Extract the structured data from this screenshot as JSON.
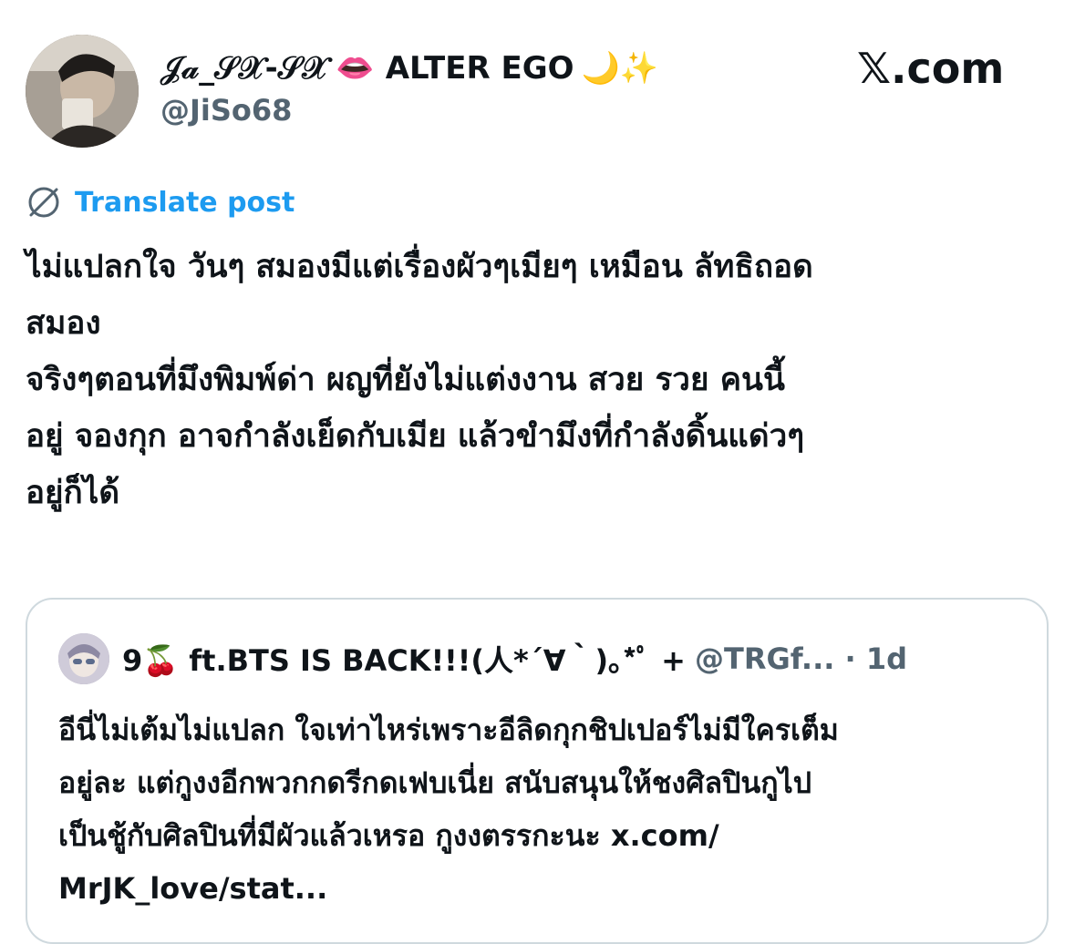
{
  "post": {
    "author": {
      "display_name": "𝒥𝒶_𝒮𝒳-𝒮𝒳",
      "name_emoji": "👄",
      "name_suffix": "ALTER EGO",
      "name_suffix_emoji": "🌙✨",
      "handle": "@JiSo68"
    },
    "brand": "𝕏.com",
    "translate_label": "Translate post",
    "text_lines": [
      "ไม่แปลกใจ วันๆ สมองมีแต่เรื่องผัวๆเมียๆ เหมือน ลัทธิถอด",
      "สมอง",
      "จริงๆตอนที่มึงพิมพ์ด่า ผญที่ยังไม่แต่งงาน สวย รวย คนนี้",
      "อยู่ จองกุก อาจกำลังเย็ดกับเมีย แล้วขำมึงที่กำลังดิ้นแด่วๆ",
      "อยู่ก็ได้"
    ]
  },
  "quote": {
    "author_name": "9🍒 ft.BTS IS BACK!!!(人*´∀｀)｡*ﾟ +",
    "handle_time": "@TRGf... · 1d",
    "text_lines": [
      "อีนี่ไม่เต้มไม่แปลก ใจเท่าไหร่เพราะอีลิดกุกชิปเปอร์ไม่มีใครเต็ม",
      "อยู่ละ แต่กูงงอีกพวกกดรีกดเฟบเนี่ย สนับสนุนให้ชงศิลปินกูไป",
      "เป็นชู้กับศิลปินที่มีผัวแล้วเหรอ กูงงตรรกะนะ x.com/",
      "MrJK_love/stat..."
    ]
  },
  "colors": {
    "link_blue": "#1d9bf0",
    "secondary_text": "#536471",
    "border": "#cfd9de",
    "primary_text": "#0f1419"
  },
  "icons": {
    "translate": "globe-icon"
  }
}
